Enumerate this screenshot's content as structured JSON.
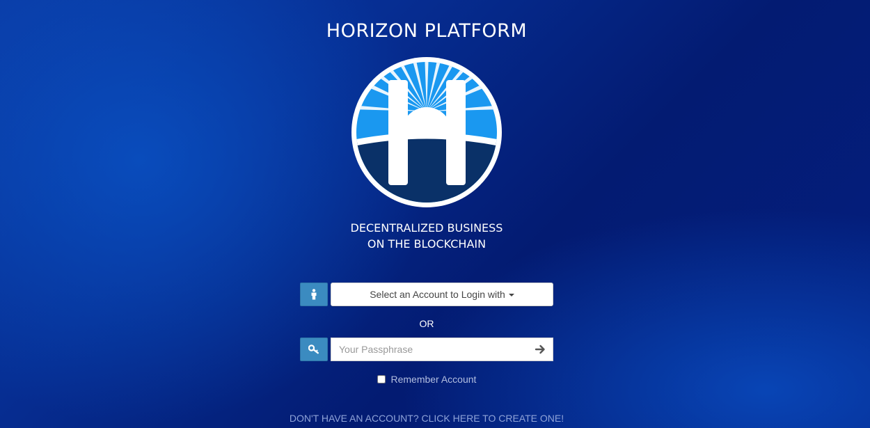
{
  "header": {
    "title": "HORIZON PLATFORM"
  },
  "logo": {
    "icon": "horizon-logo-icon",
    "colors": {
      "sky": "#1a98f0",
      "ground": "#0a3168",
      "ring": "#ffffff"
    }
  },
  "tagline": {
    "line1": "DECENTRALIZED BUSINESS",
    "line2": "ON THE BLOCKCHAIN"
  },
  "login": {
    "account_select_label": "Select an Account to Login with",
    "account_icon": "user-icon",
    "or_label": "OR",
    "passphrase_icon": "key-icon",
    "passphrase_placeholder": "Your Passphrase",
    "passphrase_value": "",
    "submit_icon": "arrow-right-icon",
    "remember_label": "Remember Account",
    "remember_checked": false
  },
  "footer": {
    "create_account_link": "DON'T HAVE AN ACCOUNT? CLICK HERE TO CREATE ONE!"
  },
  "colors": {
    "accent": "#3b8bc0",
    "background": "#062e93"
  }
}
